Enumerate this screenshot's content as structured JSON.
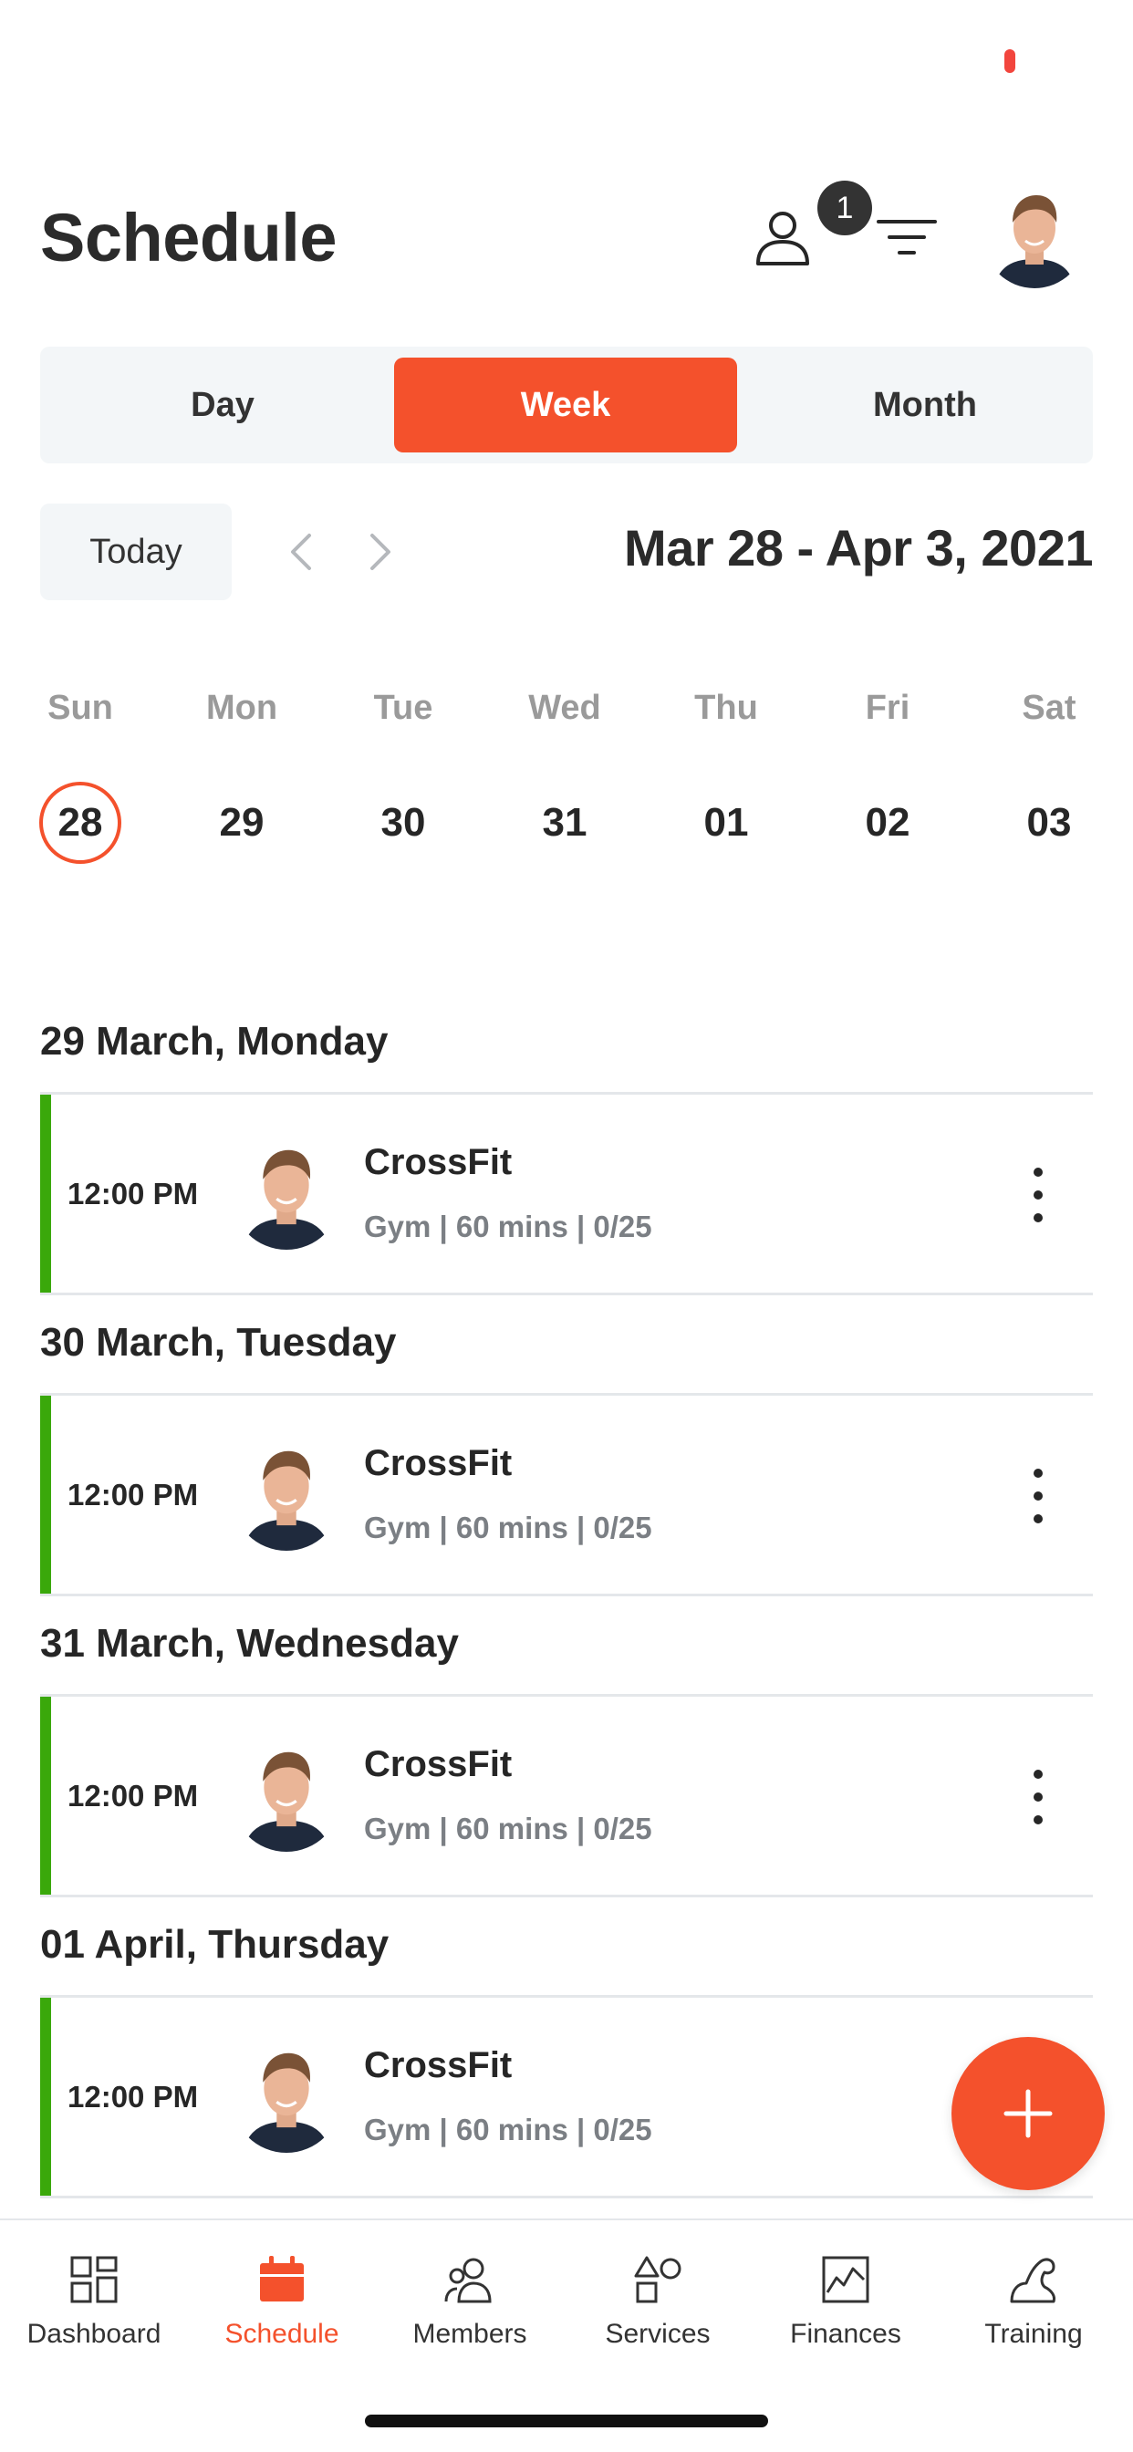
{
  "header": {
    "title": "Schedule",
    "notification_count": "1"
  },
  "view_tabs": [
    {
      "label": "Day"
    },
    {
      "label": "Week"
    },
    {
      "label": "Month"
    }
  ],
  "date_nav": {
    "today_label": "Today",
    "range": "Mar 28 - Apr 3, 2021"
  },
  "week": {
    "days": [
      {
        "name": "Sun",
        "num": "28"
      },
      {
        "name": "Mon",
        "num": "29"
      },
      {
        "name": "Tue",
        "num": "30"
      },
      {
        "name": "Wed",
        "num": "31"
      },
      {
        "name": "Thu",
        "num": "01"
      },
      {
        "name": "Fri",
        "num": "02"
      },
      {
        "name": "Sat",
        "num": "03"
      }
    ],
    "selected": "28"
  },
  "sections": [
    {
      "title": "29 March, Monday",
      "events": [
        {
          "time": "12:00 PM",
          "title": "CrossFit",
          "meta": "Gym | 60 mins | 0/25"
        }
      ]
    },
    {
      "title": "30 March, Tuesday",
      "events": [
        {
          "time": "12:00 PM",
          "title": "CrossFit",
          "meta": "Gym | 60 mins | 0/25"
        }
      ]
    },
    {
      "title": "31 March, Wednesday",
      "events": [
        {
          "time": "12:00 PM",
          "title": "CrossFit",
          "meta": "Gym | 60 mins | 0/25"
        }
      ]
    },
    {
      "title": "01 April, Thursday",
      "events": [
        {
          "time": "12:00 PM",
          "title": "CrossFit",
          "meta": "Gym | 60 mins | 0/25"
        }
      ]
    }
  ],
  "tabbar": [
    {
      "label": "Dashboard",
      "icon": "dashboard-icon"
    },
    {
      "label": "Schedule",
      "icon": "calendar-icon",
      "active": true
    },
    {
      "label": "Members",
      "icon": "members-icon"
    },
    {
      "label": "Services",
      "icon": "services-icon"
    },
    {
      "label": "Finances",
      "icon": "finances-icon"
    },
    {
      "label": "Training",
      "icon": "training-icon"
    }
  ],
  "colors": {
    "accent": "#f4512c",
    "event_bar": "#3aa80b"
  }
}
